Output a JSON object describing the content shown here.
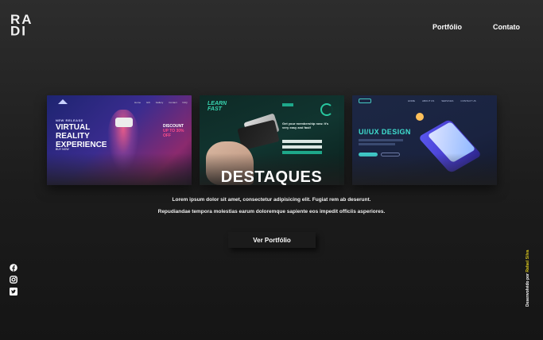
{
  "brand": {
    "logo_top": "RA",
    "logo_bottom": "DI"
  },
  "nav": {
    "items": [
      "Portfólio",
      "Contato"
    ]
  },
  "cards": {
    "vr": {
      "new_release": "NEW RELEASE",
      "headline": "VIRTUAL REALITY EXPERIENCE",
      "discount_line1": "DISCOUNT",
      "discount_line2": "UP TO 30% OFF",
      "buy": "BUY NOW",
      "menu": [
        "Home",
        "Gift",
        "Gallery",
        "Contact",
        "FAQ"
      ]
    },
    "learn": {
      "brand": "LEARN FAST",
      "headline": "Get your membership now. It's very easy and fast!"
    },
    "uiux": {
      "headline": "UI/UX DESIGN",
      "menu": [
        "HOME",
        "ABOUT US",
        "SERVICES",
        "CONTACT US"
      ]
    }
  },
  "hero": {
    "title": "DESTAQUES",
    "line1": "Lorem ipsum dolor sit amet, consectetur adipisicing elit. Fugiat rem ab deserunt.",
    "line2": "Repudiandae tempora molestias earum doloremque sapiente eos impedit officiis asperiores.",
    "cta": "Ver Portfólio"
  },
  "footer": {
    "dev_prefix": "Desenvolvido por",
    "dev_name": "Rafael Silva"
  },
  "colors": {
    "accent": "#d6c41e",
    "background": "#1c1c1c"
  },
  "social_icons": [
    "facebook-icon",
    "instagram-icon",
    "twitter-icon"
  ]
}
